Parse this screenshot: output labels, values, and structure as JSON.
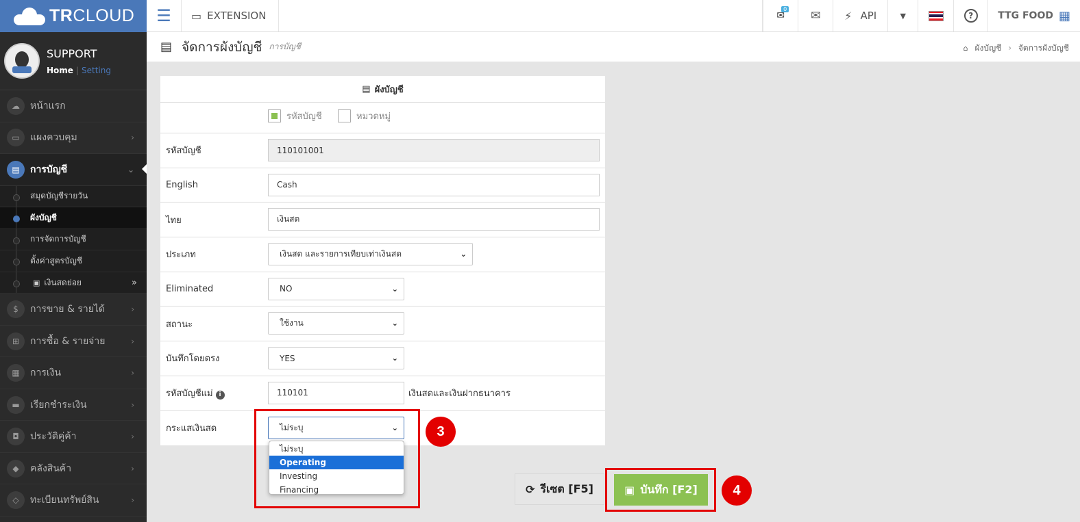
{
  "app": {
    "brand_bold": "TR",
    "brand_rest": "CLOUD"
  },
  "topbar": {
    "extension_label": "EXTENSION",
    "notif_count": "0",
    "api_label": "API",
    "company": "TTG FOOD",
    "flag_colors": [
      "#ed1c24",
      "#ffffff",
      "#241d4f",
      "#ffffff",
      "#ed1c24"
    ]
  },
  "sidebar": {
    "user_name": "SUPPORT",
    "home_link": "Home",
    "setting_link": "Setting",
    "items_top": [
      {
        "label": "หน้าแรก",
        "icon": "cloud-icon",
        "glyph": "☁"
      },
      {
        "label": "แผงควบคุม",
        "icon": "monitor-icon",
        "glyph": "▭"
      }
    ],
    "active_item": {
      "label": "การบัญชี",
      "icon": "book-icon",
      "glyph": "▤"
    },
    "sub_items": [
      {
        "label": "สมุดบัญชีรายวัน"
      },
      {
        "label": "ผังบัญชี"
      },
      {
        "label": "การจัดการบัญชี"
      },
      {
        "label": "ตั้งค่าสูตรบัญชี"
      },
      {
        "label": "เงินสดย่อย"
      }
    ],
    "items_bottom": [
      {
        "label": "การขาย & รายได้",
        "icon": "dollar-icon",
        "glyph": "$"
      },
      {
        "label": "การซื้อ & รายจ่าย",
        "icon": "cart-icon",
        "glyph": "⊞"
      },
      {
        "label": "การเงิน",
        "icon": "calendar-icon",
        "glyph": "▦"
      },
      {
        "label": "เรียกชำระเงิน",
        "icon": "credit-card-icon",
        "glyph": "▬"
      },
      {
        "label": "ประวัติคู่ค้า",
        "icon": "contact-icon",
        "glyph": "◘"
      },
      {
        "label": "คลังสินค้า",
        "icon": "cubes-icon",
        "glyph": "◆"
      },
      {
        "label": "ทะเบียนทรัพย์สิน",
        "icon": "diamond-icon",
        "glyph": "◇"
      }
    ]
  },
  "page": {
    "title": "จัดการผังบัญชี",
    "subtitle": "การบัญชี",
    "breadcrumb": [
      "ผังบัญชี",
      "จัดการผังบัญชี"
    ]
  },
  "form": {
    "panel_title": "ผังบัญชี",
    "check_account_code": "รหัสบัญชี",
    "check_category": "หมวดหมู่",
    "fields": {
      "code": {
        "label": "รหัสบัญชี",
        "value": "110101001"
      },
      "english": {
        "label": "English",
        "value": "Cash"
      },
      "thai": {
        "label": "ไทย",
        "value": "เงินสด"
      },
      "type": {
        "label": "ประเภท",
        "value": "เงินสด และรายการเทียบเท่าเงินสด"
      },
      "eliminated": {
        "label": "Eliminated",
        "value": "NO"
      },
      "status": {
        "label": "สถานะ",
        "value": "ใช้งาน"
      },
      "direct": {
        "label": "บันทึกโดยตรง",
        "value": "YES"
      },
      "parent": {
        "label": "รหัสบัญชีแม่",
        "value": "110101",
        "description": "เงินสดและเงินฝากธนาคาร"
      },
      "cashflow": {
        "label": "กระแสเงินสด",
        "value": "ไม่ระบุ"
      }
    },
    "cashflow_options": [
      "ไม่ระบุ",
      "Operating",
      "Investing",
      "Financing"
    ],
    "highlighted_option": "Operating"
  },
  "buttons": {
    "reset": "รีเซต [F5]",
    "save": "บันทึก [F2]"
  },
  "callouts": {
    "step3": "3",
    "step4": "4"
  }
}
